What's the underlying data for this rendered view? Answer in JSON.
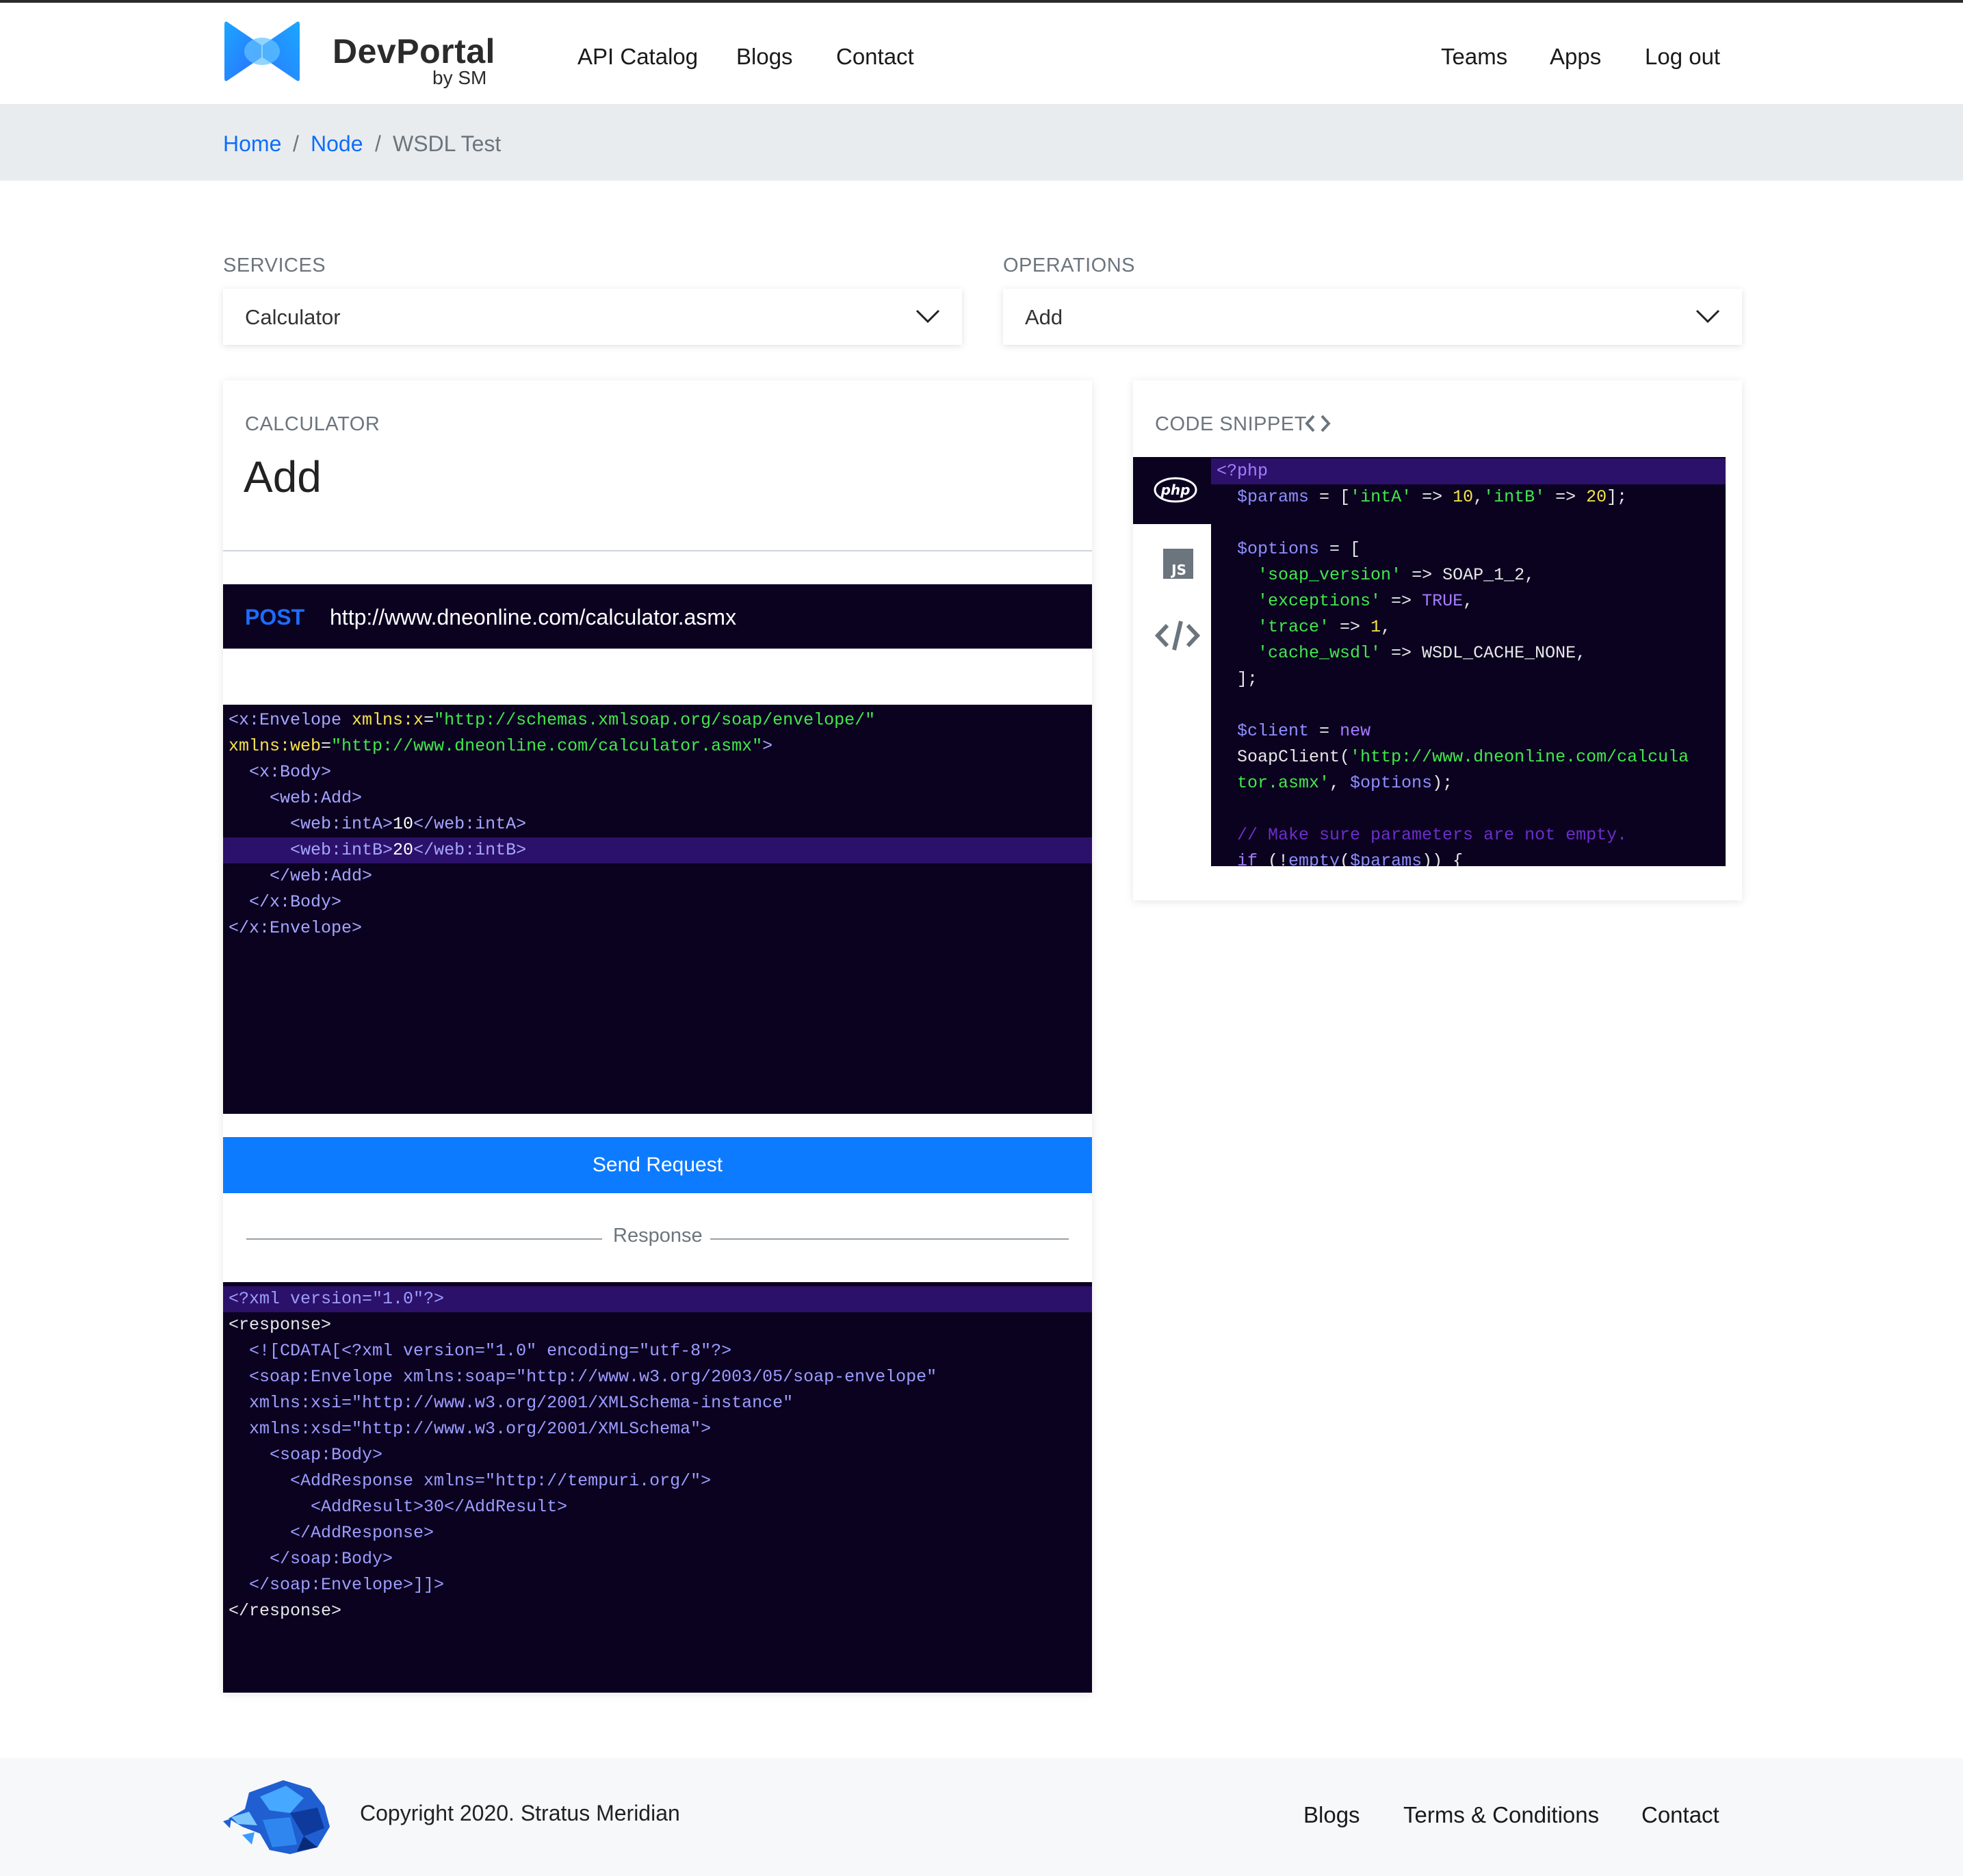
{
  "header": {
    "brand": "DevPortal",
    "brand_sub": "by SM",
    "nav": [
      "API Catalog",
      "Blogs",
      "Contact"
    ],
    "nav_right": [
      "Teams",
      "Apps",
      "Log out"
    ]
  },
  "breadcrumb": {
    "items": [
      "Home",
      "Node",
      "WSDL Test"
    ],
    "separator": "/"
  },
  "services": {
    "label": "SERVICES",
    "selected": "Calculator"
  },
  "operations": {
    "label": "OPERATIONS",
    "selected": "Add"
  },
  "operation_panel": {
    "service_name": "CALCULATOR",
    "operation_name": "Add",
    "method": "POST",
    "endpoint": "http://www.dneonline.com/calculator.asmx",
    "send_label": "Send Request",
    "response_label": "Response"
  },
  "request_xml": [
    "<x:Envelope xmlns:x=\"http://schemas.xmlsoap.org/soap/envelope/\"",
    "xmlns:web=\"http://www.dneonline.com/calculator.asmx\">",
    "  <x:Body>",
    "    <web:Add>",
    "      <web:intA>10</web:intA>",
    "      <web:intB>20</web:intB>",
    "    </web:Add>",
    "  </x:Body>",
    "</x:Envelope>"
  ],
  "response_xml": [
    "<?xml version=\"1.0\"?>",
    "<response>",
    "  <![CDATA[<?xml version=\"1.0\" encoding=\"utf-8\"?>",
    "  <soap:Envelope xmlns:soap=\"http://www.w3.org/2003/05/soap-envelope\"",
    "  xmlns:xsi=\"http://www.w3.org/2001/XMLSchema-instance\"",
    "  xmlns:xsd=\"http://www.w3.org/2001/XMLSchema\">",
    "    <soap:Body>",
    "      <AddResponse xmlns=\"http://tempuri.org/\">",
    "        <AddResult>30</AddResult>",
    "      </AddResponse>",
    "    </soap:Body>",
    "  </soap:Envelope>]]>",
    "</response>"
  ],
  "code_snippet": {
    "title": "CODE SNIPPET",
    "languages": [
      {
        "name": "php",
        "icon": "php-icon"
      },
      {
        "name": "JS",
        "icon": "javascript-icon"
      },
      {
        "name": "embed",
        "icon": "code-icon"
      }
    ],
    "lines": [
      "<?php",
      "  $params = ['intA' => 10,'intB' => 20];",
      "",
      "  $options = [",
      "    'soap_version' => SOAP_1_2,",
      "    'exceptions' => TRUE,",
      "    'trace' => 1,",
      "    'cache_wsdl' => WSDL_CACHE_NONE,",
      "  ];",
      "",
      "  $client = new",
      "  SoapClient('http://www.dneonline.com/calcula",
      "  tor.asmx', $options);",
      "",
      "  // Make sure parameters are not empty.",
      "  if (!empty($params)) {"
    ]
  },
  "footer": {
    "copyright": "Copyright 2020. Stratus Meridian",
    "links": [
      "Blogs",
      "Terms & Conditions",
      "Contact"
    ]
  },
  "colors": {
    "accent": "#0d7bff",
    "link": "#0d6efd",
    "code_bg": "#0b0220",
    "code_highlight": "#2b1169"
  }
}
